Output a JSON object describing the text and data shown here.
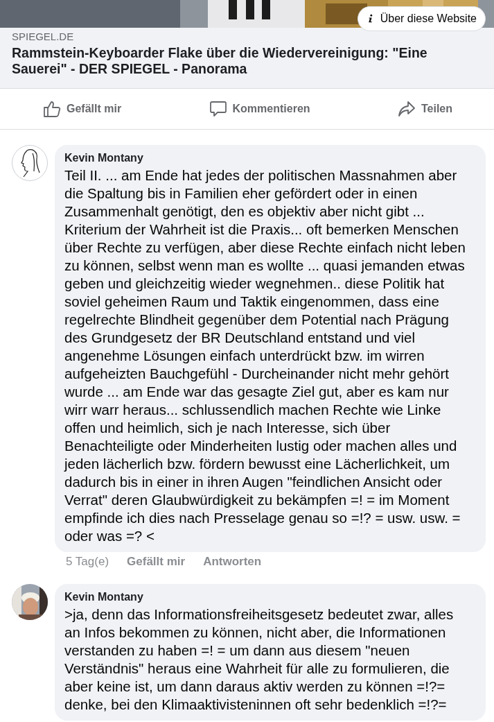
{
  "link_preview": {
    "kind": "picture",
    "info_button": "Über diese Website",
    "domain": "SPIEGEL.DE",
    "title": "Rammstein-Keyboarder Flake über die Wiedervereinigung: \"Eine Sauerei\" - DER SPIEGEL - Panorama"
  },
  "actions": [
    {
      "kind": "like",
      "label": "Gefällt mir"
    },
    {
      "kind": "comment",
      "label": "Kommentieren"
    },
    {
      "kind": "share",
      "label": "Teilen"
    }
  ],
  "comments": [
    {
      "kind": "sketch",
      "author": "Kevin Montany",
      "text": "Teil II. ... am Ende hat jedes der politischen Massnahmen aber die Spaltung bis in Familien eher  gefördert oder in einen Zusammenhalt genötigt, den es objektiv aber nicht gibt ... Kriterium der Wahrheit ist die Praxis... oft bemerken Menschen über Rechte zu verfügen, aber diese Rechte einfach nicht leben zu können, selbst wenn man es wollte ... quasi jemanden etwas geben und gleichzeitig wieder wegnehmen.. diese Politik hat soviel geheimen Raum und Taktik eingenommen, dass eine regelrechte Blindheit gegenüber dem Potential nach Prägung des Grundgesetz der BR Deutschland entstand und viel angenehme Lösungen einfach unterdrückt bzw. im wirren aufgeheizten Bauchgefühl - Durcheinander nicht mehr gehört wurde ... am Ende war das gesagte Ziel gut, aber es kam nur wirr warr heraus... schlussendlich machen Rechte wie Linke offen und heimlich, sich je nach Interesse, sich  über Benachteiligte oder Minderheiten lustig oder machen alles und jeden lächerlich bzw. fördern bewusst eine Lächerlichkeit, um dadurch  bis in einer in ihren Augen \"feindlichen Ansicht oder Verrat\" deren Glaubwürdigkeit zu bekämpfen =! = im Moment empfinde ich dies nach Presselage genau so =!? = usw. usw. = oder was =? <",
      "time": "5 Tag(e)",
      "like": "Gefällt mir",
      "reply": "Antworten"
    },
    {
      "author": "Kevin Montany",
      "text": ">ja, denn das Informationsfreiheitsgesetz bedeutet zwar, alles an Infos bekommen zu können, nicht aber, die Informationen verstanden zu haben =! = um dann aus diesem \"neuen Verständnis\" heraus eine Wahrheit für alle zu formulieren, die aber keine ist, um dann daraus aktiv werden zu können =!?= denke, bei den Klimaaktivisteninnen oft sehr bedenklich =!?="
    }
  ]
}
